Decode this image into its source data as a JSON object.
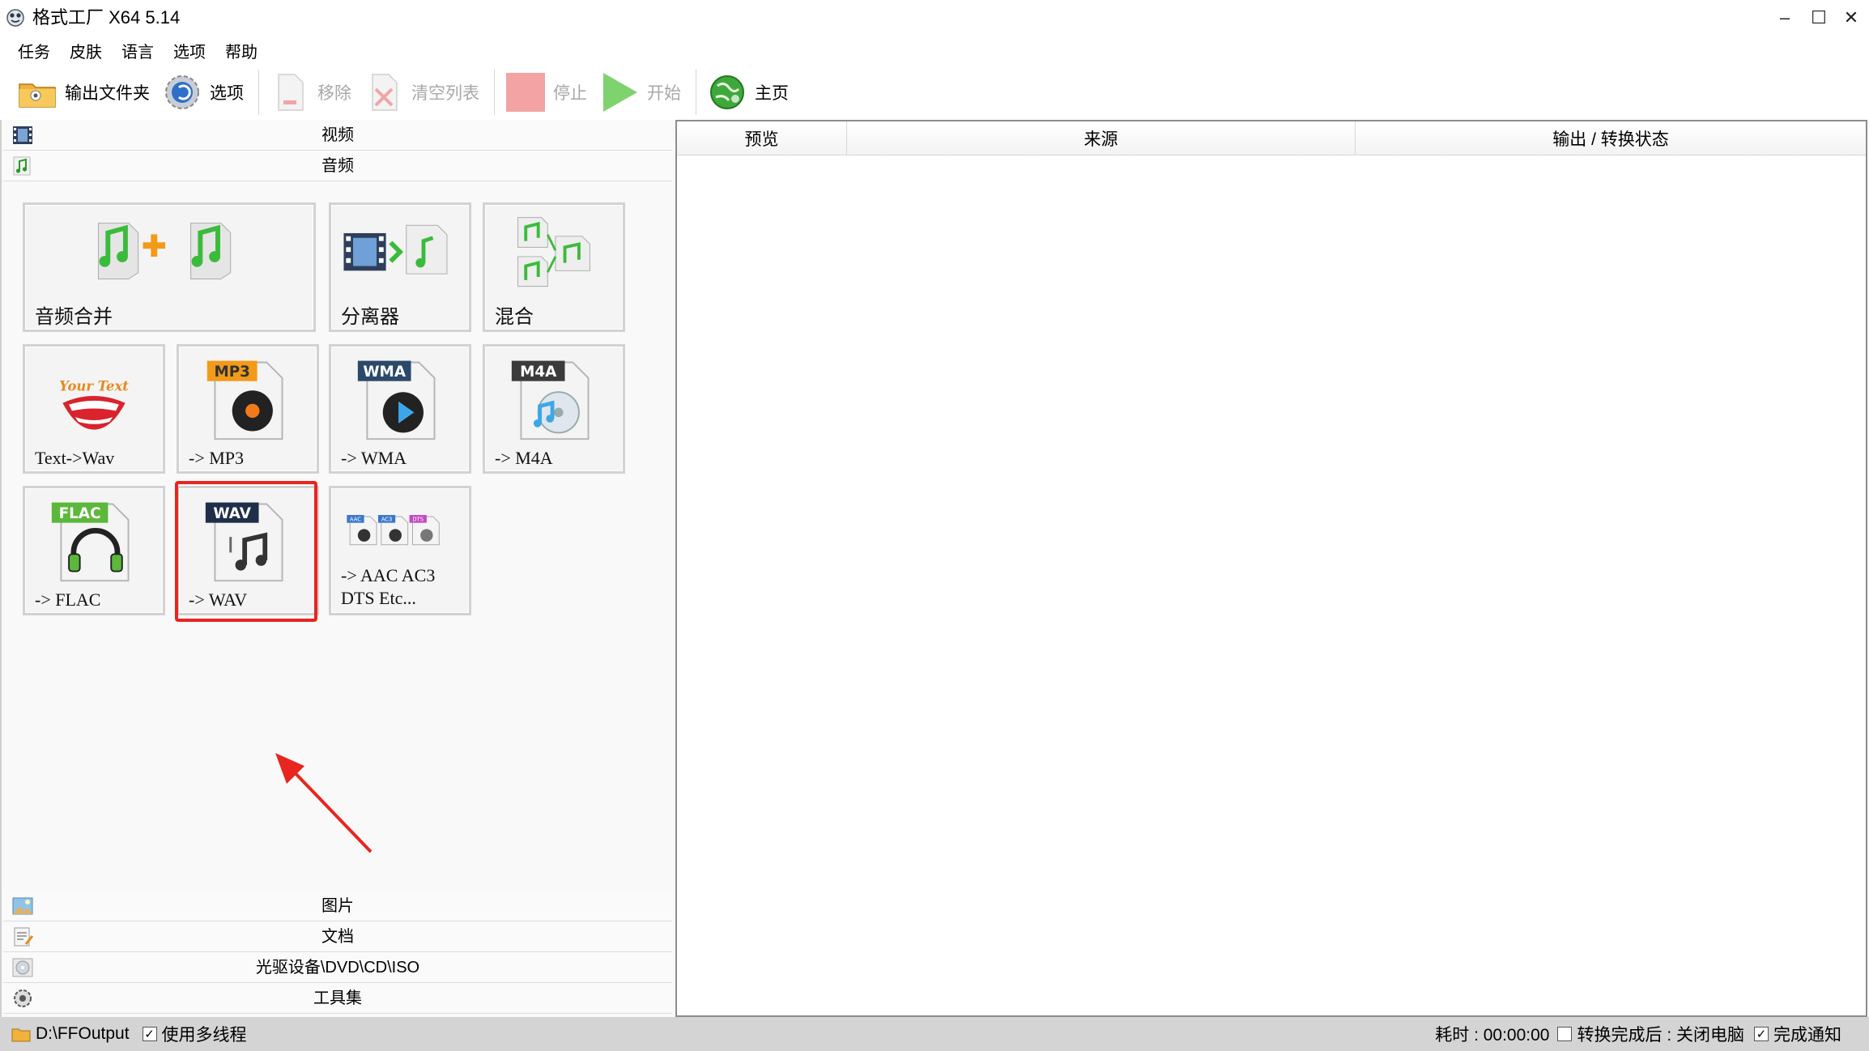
{
  "window": {
    "title": "格式工厂 X64 5.14",
    "controls": {
      "minimize": "–",
      "maximize": "☐",
      "close": "✕"
    }
  },
  "menu": [
    "任务",
    "皮肤",
    "语言",
    "选项",
    "帮助"
  ],
  "toolbar": {
    "output_folder": "输出文件夹",
    "options": "选项",
    "remove": "移除",
    "clear_list": "清空列表",
    "stop": "停止",
    "start": "开始",
    "home": "主页"
  },
  "categories": {
    "video": "视频",
    "audio": "音频",
    "picture": "图片",
    "document": "文档",
    "rom": "光驱设备\\DVD\\CD\\ISO",
    "tools": "工具集"
  },
  "tiles": {
    "audio_merge": "音频合并",
    "splitter": "分离器",
    "mix": "混合",
    "text_wav": "Text->Wav",
    "mp3": "-> MP3",
    "wma": "-> WMA",
    "m4a": "-> M4A",
    "flac": "-> FLAC",
    "wav": "-> WAV",
    "aac": "-> AAC AC3\nDTS Etc...",
    "icon_badges": {
      "mp3": "MP3",
      "wma": "WMA",
      "m4a": "M4A",
      "flac": "FLAC",
      "wav": "WAV",
      "your_text": "Your Text",
      "aac_small": [
        "AAC",
        "AC3",
        "DTS"
      ]
    }
  },
  "grid": {
    "columns": [
      "预览",
      "来源",
      "输出 / 转换状态"
    ]
  },
  "status": {
    "output_path": "D:\\FFOutput",
    "multithread": "使用多线程",
    "multithread_checked": true,
    "elapsed": "耗时 : 00:00:00",
    "after_convert": "转换完成后 : 关闭电脑",
    "after_convert_checked": false,
    "notify": "完成通知",
    "notify_checked": true
  },
  "colors": {
    "highlight": "#e8251f",
    "arrow": "#e8251f",
    "status_bg": "#d4d4d4"
  }
}
